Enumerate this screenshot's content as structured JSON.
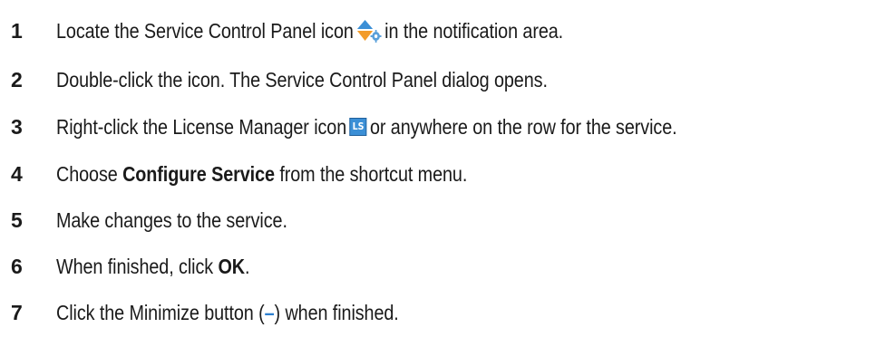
{
  "steps": [
    {
      "number": "1",
      "text_before": "Locate the Service Control Panel icon",
      "icon": "service-control-panel-icon",
      "text_after": "in the notification area."
    },
    {
      "number": "2",
      "text": "Double-click the icon. The Service Control Panel dialog opens."
    },
    {
      "number": "3",
      "text_before": "Right-click the License Manager icon",
      "icon": "license-manager-icon",
      "icon_label": "LS",
      "text_after": "or anywhere on the row for the service."
    },
    {
      "number": "4",
      "text_before": "Choose",
      "bold": "Configure Service",
      "text_after": "from the shortcut menu."
    },
    {
      "number": "5",
      "text": "Make changes to the service."
    },
    {
      "number": "6",
      "text_before": "When finished, click",
      "bold": "OK",
      "text_after": "."
    },
    {
      "number": "7",
      "text_before": "Click the Minimize button (",
      "glyph": "–",
      "text_after": ") when finished."
    }
  ],
  "colors": {
    "text": "#1a1a1a",
    "accent_blue": "#2d7fd0",
    "icon_orange": "#f39c2b",
    "icon_blue": "#3b8fd6"
  }
}
